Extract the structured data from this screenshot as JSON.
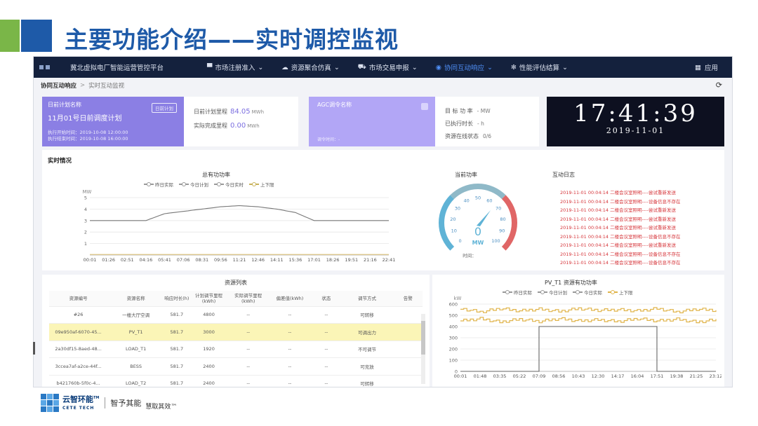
{
  "slide": {
    "title": "主要功能介绍——实时调控监视",
    "colors": {
      "title": "#1e5aa8",
      "accent_green": "#7ab648",
      "accent_blue": "#1e5aa8"
    }
  },
  "topnav": {
    "app_name": "冀北虚拟电厂智能运营管控平台",
    "items": [
      {
        "icon": "monitor-icon",
        "label": "市场注册准入"
      },
      {
        "icon": "cloud-icon",
        "label": "资源聚合仿真"
      },
      {
        "icon": "car-icon",
        "label": "市场交易申报"
      },
      {
        "icon": "signal-icon",
        "label": "协同互动响应"
      },
      {
        "icon": "gear-icon",
        "label": "性能评估结算"
      }
    ],
    "active_index": 3,
    "apps_label": "应用"
  },
  "breadcrumb": {
    "parent": "协同互动响应",
    "separator": ">",
    "current": "实时互动监视"
  },
  "plan_card": {
    "label": "日前计划名称",
    "badge": "日前计划",
    "name": "11月01号日前调度计划",
    "start": "执行开始时间：2019-10-08 12:00:00",
    "end": "执行结束时间：2019-10-08 16:00:00"
  },
  "plan_stats": {
    "planned_label": "日前计划里程",
    "planned_value": "84.05",
    "planned_unit": "MWh",
    "actual_label": "实际完成里程",
    "actual_value": "0.00",
    "actual_unit": "MWh"
  },
  "agc_card": {
    "label": "AGC调令名称",
    "footer": "调令时间：-"
  },
  "agc_stats": {
    "power_label": "目 标 功 率",
    "power_value": "- MW",
    "duration_label": "已执行时长",
    "duration_value": "- h",
    "online_label": "资源在线状态",
    "online_value": "0/6"
  },
  "clock": {
    "time": "17:41:39",
    "date": "2019-11-01"
  },
  "realtime": {
    "header": "实时情况",
    "log_title": "互动日志",
    "log_entries": [
      "2019-11-01 00:04:14 二楼会议室照明----尝试重新发送",
      "2019-11-01 00:04:14 二楼会议室照明----设备信息不存在",
      "2019-11-01 00:04:14 二楼会议室照明----尝试重新发送",
      "2019-11-01 00:04:14 二楼会议室照明----尝试重新发送",
      "2019-11-01 00:04:14 二楼会议室照明----尝试重新发送",
      "2019-11-01 00:04:14 二楼会议室照明----设备信息不存在",
      "2019-11-01 00:04:14 二楼会议室照明----尝试重新发送",
      "2019-11-01 00:04:14 二楼会议室照明----设备信息不存在",
      "2019-11-01 00:04:14 二楼会议室照明----设备信息不存在"
    ]
  },
  "resources": {
    "title": "资源列表",
    "columns": [
      "资源编号",
      "资源名称",
      "响应时长(h)",
      "计划调节里程(kWh)",
      "实际调节里程(kWh)",
      "偏差值(kWh)",
      "状态",
      "调节方式",
      "告警"
    ],
    "rows": [
      [
        "#26",
        "一楼大厅空调",
        "581.7",
        "4800",
        "--",
        "--",
        "--",
        "可转移",
        ""
      ],
      [
        "09e950af-6070-45...",
        "PV_T1",
        "581.7",
        "3000",
        "--",
        "--",
        "--",
        "可调出力",
        ""
      ],
      [
        "2a30df15-8aed-48...",
        "LOAD_T1",
        "581.7",
        "1920",
        "--",
        "--",
        "--",
        "不可调节",
        ""
      ],
      [
        "3ccea7af-a2ce-44f...",
        "BESS",
        "581.7",
        "2400",
        "--",
        "--",
        "--",
        "可充放",
        ""
      ],
      [
        "b421760b-5f0c-4...",
        "LOAD_T2",
        "581.7",
        "2400",
        "--",
        "--",
        "--",
        "可转移",
        ""
      ]
    ],
    "selected_index": 1
  },
  "chart_data": [
    {
      "type": "line",
      "title": "总有功功率",
      "ylabel": "MW",
      "ylim": [
        0,
        5
      ],
      "yticks": [
        1,
        2,
        3,
        4,
        5
      ],
      "x": [
        "00:01",
        "01:26",
        "02:51",
        "04:16",
        "05:41",
        "07:06",
        "08:31",
        "09:56",
        "11:21",
        "12:46",
        "14:11",
        "15:36",
        "17:01",
        "18:26",
        "19:51",
        "21:16",
        "22:41"
      ],
      "legend": [
        "昨日实际",
        "今日计划",
        "今日实时",
        "上下限"
      ],
      "grid": true,
      "legend_position": "top",
      "series": [
        {
          "name": "今日计划",
          "color": "#777777",
          "values": [
            3.0,
            3.0,
            3.0,
            3.0,
            3.6,
            3.8,
            4.0,
            4.2,
            4.3,
            4.2,
            4.0,
            3.7,
            3.0,
            3.0,
            3.0,
            3.0,
            3.0
          ]
        },
        {
          "name": "上下限",
          "color": "#e3c77e",
          "values": [
            0.05,
            0.05,
            0.05,
            0.05,
            0.05,
            0.05,
            0.05,
            0.05,
            0.05,
            0.05,
            0.05,
            0.05,
            0.05,
            0.05,
            0.05,
            0.05,
            0.05
          ]
        }
      ]
    },
    {
      "type": "gauge",
      "title": "当前功率",
      "unit": "MW",
      "min": 0,
      "max": 100,
      "ticks": [
        0,
        10,
        20,
        30,
        40,
        50,
        60,
        70,
        80,
        90,
        100
      ],
      "value": 0,
      "time_label": "时间："
    },
    {
      "type": "line",
      "title": "PV_T1 资源有功功率",
      "ylabel": "kW",
      "ylim": [
        0,
        600
      ],
      "yticks": [
        0,
        100,
        200,
        300,
        400,
        500,
        600
      ],
      "x": [
        "00:01",
        "01:48",
        "03:35",
        "05:22",
        "07:09",
        "08:56",
        "10:43",
        "12:30",
        "14:17",
        "16:04",
        "17:51",
        "19:38",
        "21:25",
        "23:12"
      ],
      "legend": [
        "昨日实际",
        "今日计划",
        "今日实际",
        "上下限"
      ],
      "grid": true,
      "legend_position": "top",
      "series": [
        {
          "name": "今日计划",
          "color": "#666666",
          "values": [
            0,
            0,
            0,
            0,
            400,
            400,
            400,
            400,
            400,
            400,
            0,
            0,
            0,
            0
          ]
        },
        {
          "name": "上下限",
          "color": "#e0b44a",
          "values": [
            560,
            530,
            560,
            540,
            555,
            535,
            560,
            545,
            550,
            540,
            560,
            530,
            555,
            545
          ]
        },
        {
          "name": "上下限",
          "color": "#e0b44a",
          "values": [
            450,
            470,
            440,
            465,
            445,
            470,
            450,
            460,
            445,
            470,
            450,
            465,
            440,
            460
          ]
        }
      ]
    }
  ],
  "footer": {
    "brand": "云智环能",
    "brand_en": "CETE TECH",
    "tm": "TM",
    "slogan1": "智予其能",
    "slogan2": "慧取其效™"
  }
}
